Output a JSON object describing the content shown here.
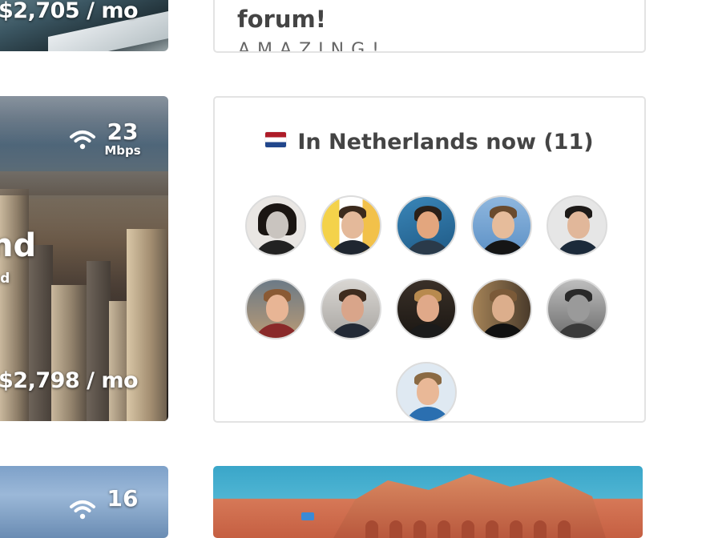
{
  "cards": [
    {
      "price": "$2,705 / mo"
    },
    {
      "city": "nd",
      "country": "nd",
      "internet": {
        "speed": "23",
        "unit": "Mbps"
      },
      "price": "$2,798 / mo"
    },
    {
      "internet": {
        "speed": "16"
      }
    }
  ],
  "forum": {
    "title": "forum!",
    "subtitle": "AMAZING!"
  },
  "people": {
    "title": "In Netherlands now (11)",
    "flag": "flag-netherlands",
    "avatars": [
      {
        "name": "member-1"
      },
      {
        "name": "member-2"
      },
      {
        "name": "member-3"
      },
      {
        "name": "member-4"
      },
      {
        "name": "member-5"
      },
      {
        "name": "member-6"
      },
      {
        "name": "member-7"
      },
      {
        "name": "member-8"
      },
      {
        "name": "member-9"
      },
      {
        "name": "member-10"
      },
      {
        "name": "member-11"
      }
    ]
  },
  "colors": {
    "panel_border": "#e3e3e3",
    "heading": "#444444",
    "flag_red": "#ae1c28",
    "flag_blue": "#21468b"
  }
}
